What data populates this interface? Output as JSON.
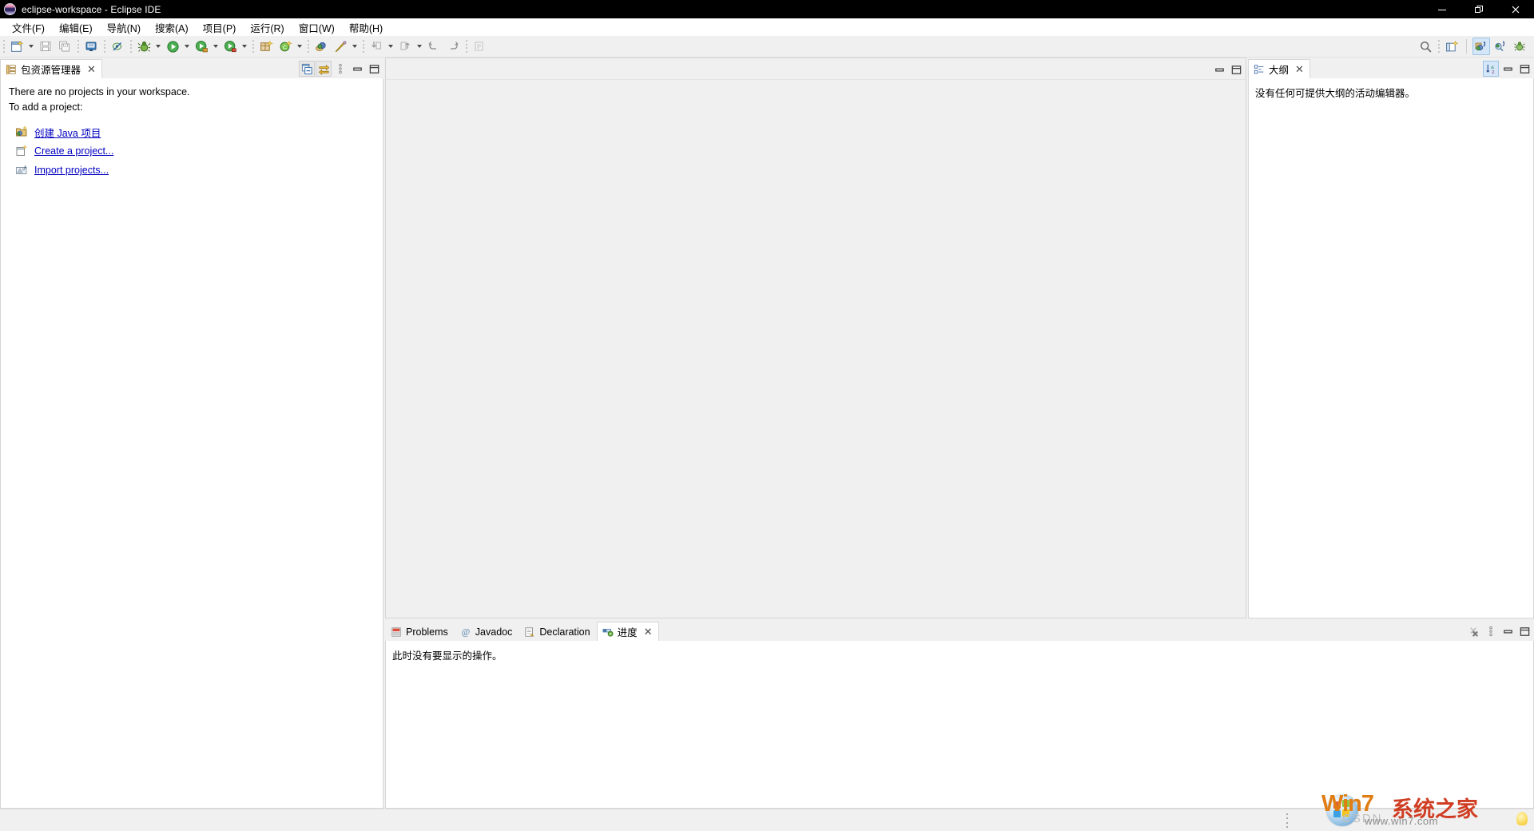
{
  "window": {
    "title": "eclipse-workspace - Eclipse IDE",
    "minimize_label": "─",
    "restore_label": "❐",
    "close_label": "✕"
  },
  "menubar": {
    "items": [
      {
        "label": "文件(F)"
      },
      {
        "label": "编辑(E)"
      },
      {
        "label": "导航(N)"
      },
      {
        "label": "搜索(A)"
      },
      {
        "label": "项目(P)"
      },
      {
        "label": "运行(R)"
      },
      {
        "label": "窗口(W)"
      },
      {
        "label": "帮助(H)"
      }
    ]
  },
  "toolbar": {
    "items": [
      {
        "name": "new-wizard-icon",
        "has_arrow": true
      },
      {
        "name": "save-icon",
        "has_arrow": false
      },
      {
        "name": "save-all-icon",
        "has_arrow": false
      },
      {
        "name": "print-icon",
        "has_arrow": false
      },
      {
        "name": "toggle-mark-occurrences-icon",
        "has_arrow": false
      },
      {
        "name": "debug-icon",
        "has_arrow": true
      },
      {
        "name": "run-icon",
        "has_arrow": true
      },
      {
        "name": "run-coverage-icon",
        "has_arrow": true
      },
      {
        "name": "external-tools-icon",
        "has_arrow": true
      },
      {
        "name": "new-java-package-icon",
        "has_arrow": false
      },
      {
        "name": "new-java-class-icon",
        "has_arrow": true
      },
      {
        "name": "open-type-icon",
        "has_arrow": false
      },
      {
        "name": "new-annotation-icon",
        "has_arrow": true
      },
      {
        "name": "next-annotation-icon",
        "has_arrow": true
      },
      {
        "name": "previous-annotation-icon",
        "has_arrow": true
      },
      {
        "name": "back-history-icon",
        "has_arrow": false
      },
      {
        "name": "forward-history-icon",
        "has_arrow": false
      },
      {
        "name": "last-edit-location-icon",
        "has_arrow": false
      }
    ],
    "right_items": [
      {
        "name": "search-icon"
      },
      {
        "name": "open-perspective-icon"
      },
      {
        "name": "perspective-java-icon",
        "active": true
      },
      {
        "name": "perspective-java-browsing-icon",
        "active": false
      },
      {
        "name": "perspective-debug-icon",
        "active": false
      }
    ]
  },
  "package_explorer": {
    "tab_label": "包资源管理器",
    "close_label": "✕",
    "message_line1": "There are no projects in your workspace.",
    "message_line2": "To add a project:",
    "links": [
      {
        "label": "创建 Java 项目",
        "icon": "new-java-project-icon"
      },
      {
        "label": "Create a project...",
        "icon": "new-project-icon"
      },
      {
        "label": "Import projects...",
        "icon": "import-projects-icon"
      }
    ],
    "toolbar": [
      {
        "name": "collapse-all-icon"
      },
      {
        "name": "link-with-editor-icon"
      },
      {
        "name": "view-menu-icon"
      },
      {
        "name": "minimize-icon"
      },
      {
        "name": "maximize-icon"
      }
    ]
  },
  "editor_area": {
    "toolbar": [
      {
        "name": "minimize-icon"
      },
      {
        "name": "maximize-icon"
      }
    ]
  },
  "outline": {
    "tab_label": "大纲",
    "close_label": "✕",
    "message": "没有任何可提供大纲的活动编辑器。",
    "toolbar": [
      {
        "name": "sort-icon",
        "active": true
      },
      {
        "name": "minimize-icon"
      },
      {
        "name": "maximize-icon"
      }
    ]
  },
  "bottom_panel": {
    "tabs": [
      {
        "label": "Problems",
        "icon": "problems-icon",
        "active": false,
        "closable": false
      },
      {
        "label": "Javadoc",
        "icon": "javadoc-icon",
        "active": false,
        "closable": false
      },
      {
        "label": "Declaration",
        "icon": "declaration-icon",
        "active": false,
        "closable": false
      },
      {
        "label": "进度",
        "icon": "progress-icon",
        "active": true,
        "closable": true
      }
    ],
    "close_label": "✕",
    "message": "此时没有要显示的操作。",
    "toolbar": [
      {
        "name": "remove-all-finished-icon"
      },
      {
        "name": "view-menu-icon"
      },
      {
        "name": "minimize-icon"
      },
      {
        "name": "maximize-icon"
      }
    ]
  },
  "watermark": {
    "brand_en": "Win7",
    "brand_cn": "系统之家",
    "url": "www.win7.com",
    "overlay": "CSDN"
  },
  "colors": {
    "titlebar_bg": "#000000",
    "toolbar_bg": "#f0f0f0",
    "panel_bg": "#ffffff",
    "editor_bg": "#f0f0f0",
    "link": "#0000c0",
    "tab_border": "#d6d6d6",
    "accent_active": "#d4e6f8"
  }
}
